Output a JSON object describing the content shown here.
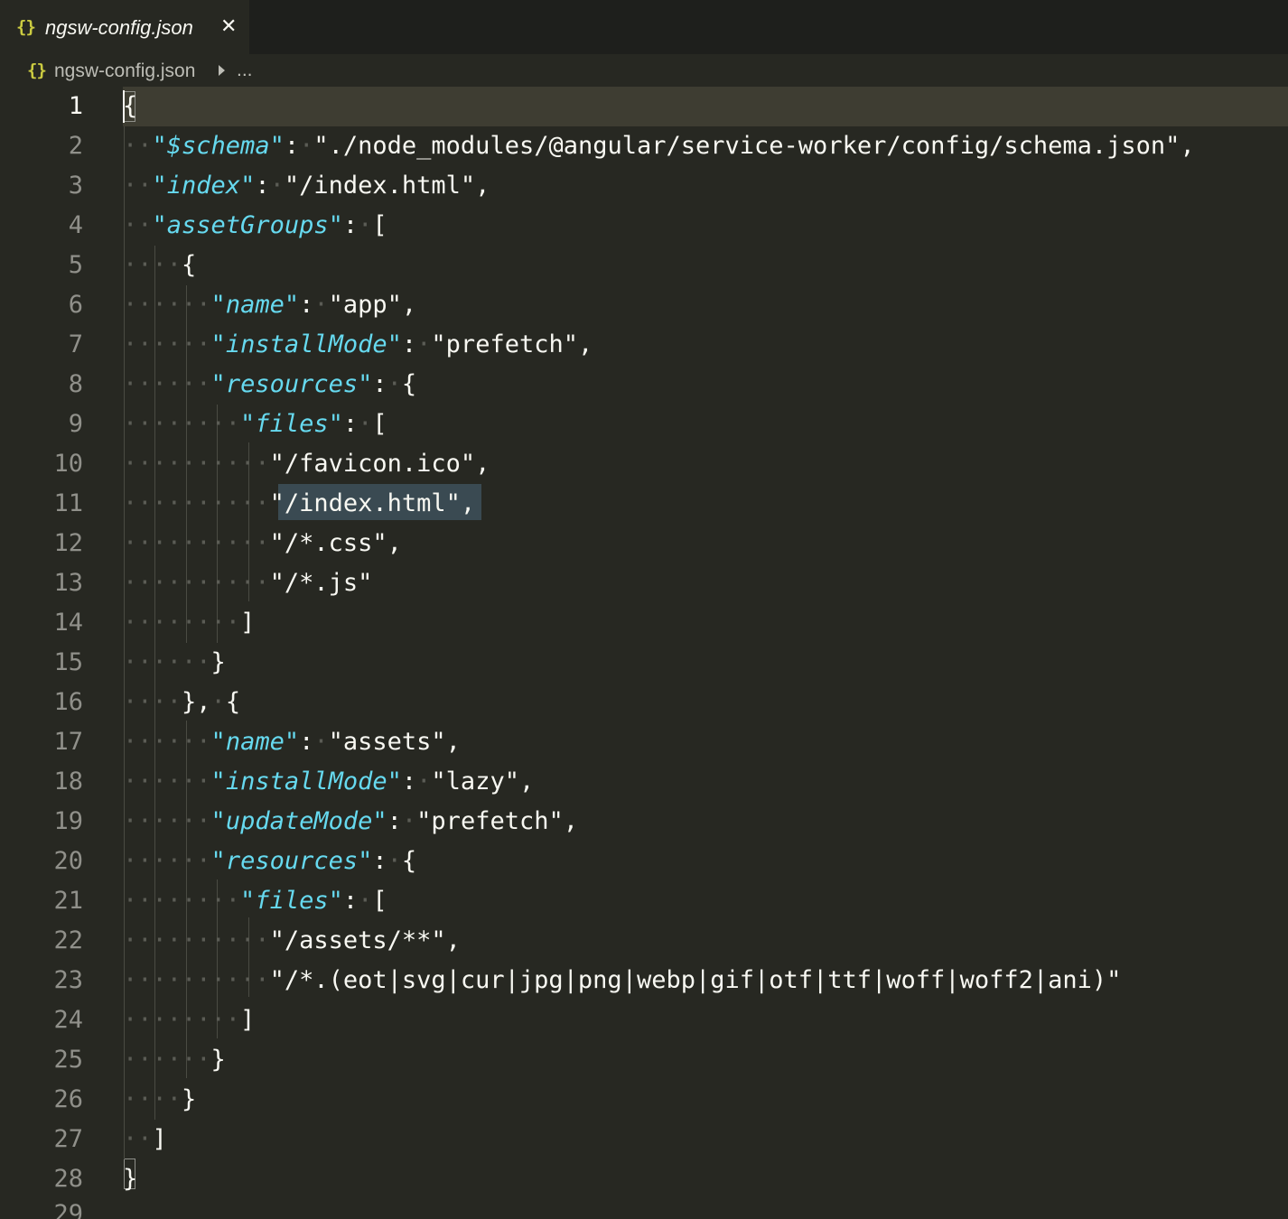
{
  "tabs": [
    {
      "label": "ngsw-config.json",
      "icon": "json-braces-icon",
      "icon_glyph": "{}",
      "active": true
    }
  ],
  "breadcrumb": {
    "icon_glyph": "{}",
    "file": "ngsw-config.json",
    "more": "..."
  },
  "colors": {
    "background": "#272822",
    "tabbar": "#1e1f1c",
    "key": "#66d9ef",
    "text": "#f8f8f2",
    "json_icon": "#cbcb41",
    "line_number": "#90908a",
    "current_line": "#3e3d32"
  },
  "editor": {
    "active_line": 1,
    "partial_line_number": "29",
    "lines": [
      {
        "n": "1",
        "indent": "",
        "parts": [
          {
            "t": "p",
            "v": "{"
          }
        ]
      },
      {
        "n": "2",
        "indent": "··",
        "parts": [
          {
            "t": "q",
            "v": "\""
          },
          {
            "t": "k",
            "v": "$schema"
          },
          {
            "t": "q",
            "v": "\""
          },
          {
            "t": "p",
            "v": ":·\"./node_modules/@angular/service-worker/config/schema.json\","
          }
        ]
      },
      {
        "n": "3",
        "indent": "··",
        "parts": [
          {
            "t": "q",
            "v": "\""
          },
          {
            "t": "k",
            "v": "index"
          },
          {
            "t": "q",
            "v": "\""
          },
          {
            "t": "p",
            "v": ":·\"/index.html\","
          }
        ]
      },
      {
        "n": "4",
        "indent": "··",
        "parts": [
          {
            "t": "q",
            "v": "\""
          },
          {
            "t": "k",
            "v": "assetGroups"
          },
          {
            "t": "q",
            "v": "\""
          },
          {
            "t": "p",
            "v": ":·["
          }
        ]
      },
      {
        "n": "5",
        "indent": "····",
        "parts": [
          {
            "t": "p",
            "v": "{"
          }
        ]
      },
      {
        "n": "6",
        "indent": "······",
        "parts": [
          {
            "t": "q",
            "v": "\""
          },
          {
            "t": "k",
            "v": "name"
          },
          {
            "t": "q",
            "v": "\""
          },
          {
            "t": "p",
            "v": ":·\"app\","
          }
        ]
      },
      {
        "n": "7",
        "indent": "······",
        "parts": [
          {
            "t": "q",
            "v": "\""
          },
          {
            "t": "k",
            "v": "installMode"
          },
          {
            "t": "q",
            "v": "\""
          },
          {
            "t": "p",
            "v": ":·\"prefetch\","
          }
        ]
      },
      {
        "n": "8",
        "indent": "······",
        "parts": [
          {
            "t": "q",
            "v": "\""
          },
          {
            "t": "k",
            "v": "resources"
          },
          {
            "t": "q",
            "v": "\""
          },
          {
            "t": "p",
            "v": ":·{"
          }
        ]
      },
      {
        "n": "9",
        "indent": "········",
        "parts": [
          {
            "t": "q",
            "v": "\""
          },
          {
            "t": "k",
            "v": "files"
          },
          {
            "t": "q",
            "v": "\""
          },
          {
            "t": "p",
            "v": ":·["
          }
        ]
      },
      {
        "n": "10",
        "indent": "··········",
        "parts": [
          {
            "t": "p",
            "v": "\"/favicon.ico\","
          }
        ]
      },
      {
        "n": "11",
        "indent": "··········",
        "parts": [
          {
            "t": "p",
            "v": "\"/index.html\","
          }
        ]
      },
      {
        "n": "12",
        "indent": "··········",
        "parts": [
          {
            "t": "p",
            "v": "\"/*.css\","
          }
        ]
      },
      {
        "n": "13",
        "indent": "··········",
        "parts": [
          {
            "t": "p",
            "v": "\"/*.js\""
          }
        ]
      },
      {
        "n": "14",
        "indent": "········",
        "parts": [
          {
            "t": "p",
            "v": "]"
          }
        ]
      },
      {
        "n": "15",
        "indent": "······",
        "parts": [
          {
            "t": "p",
            "v": "}"
          }
        ]
      },
      {
        "n": "16",
        "indent": "····",
        "parts": [
          {
            "t": "p",
            "v": "},·{"
          }
        ]
      },
      {
        "n": "17",
        "indent": "······",
        "parts": [
          {
            "t": "q",
            "v": "\""
          },
          {
            "t": "k",
            "v": "name"
          },
          {
            "t": "q",
            "v": "\""
          },
          {
            "t": "p",
            "v": ":·\"assets\","
          }
        ]
      },
      {
        "n": "18",
        "indent": "······",
        "parts": [
          {
            "t": "q",
            "v": "\""
          },
          {
            "t": "k",
            "v": "installMode"
          },
          {
            "t": "q",
            "v": "\""
          },
          {
            "t": "p",
            "v": ":·\"lazy\","
          }
        ]
      },
      {
        "n": "19",
        "indent": "······",
        "parts": [
          {
            "t": "q",
            "v": "\""
          },
          {
            "t": "k",
            "v": "updateMode"
          },
          {
            "t": "q",
            "v": "\""
          },
          {
            "t": "p",
            "v": ":·\"prefetch\","
          }
        ]
      },
      {
        "n": "20",
        "indent": "······",
        "parts": [
          {
            "t": "q",
            "v": "\""
          },
          {
            "t": "k",
            "v": "resources"
          },
          {
            "t": "q",
            "v": "\""
          },
          {
            "t": "p",
            "v": ":·{"
          }
        ]
      },
      {
        "n": "21",
        "indent": "········",
        "parts": [
          {
            "t": "q",
            "v": "\""
          },
          {
            "t": "k",
            "v": "files"
          },
          {
            "t": "q",
            "v": "\""
          },
          {
            "t": "p",
            "v": ":·["
          }
        ]
      },
      {
        "n": "22",
        "indent": "··········",
        "parts": [
          {
            "t": "p",
            "v": "\"/assets/**\","
          }
        ]
      },
      {
        "n": "23",
        "indent": "··········",
        "parts": [
          {
            "t": "p",
            "v": "\"/*.(eot|svg|cur|jpg|png|webp|gif|otf|ttf|woff|woff2|ani)\""
          }
        ]
      },
      {
        "n": "24",
        "indent": "········",
        "parts": [
          {
            "t": "p",
            "v": "]"
          }
        ]
      },
      {
        "n": "25",
        "indent": "······",
        "parts": [
          {
            "t": "p",
            "v": "}"
          }
        ]
      },
      {
        "n": "26",
        "indent": "····",
        "parts": [
          {
            "t": "p",
            "v": "}"
          }
        ]
      },
      {
        "n": "27",
        "indent": "··",
        "parts": [
          {
            "t": "p",
            "v": "]"
          }
        ]
      },
      {
        "n": "28",
        "indent": "",
        "parts": [
          {
            "t": "p",
            "v": "}"
          }
        ]
      }
    ]
  }
}
